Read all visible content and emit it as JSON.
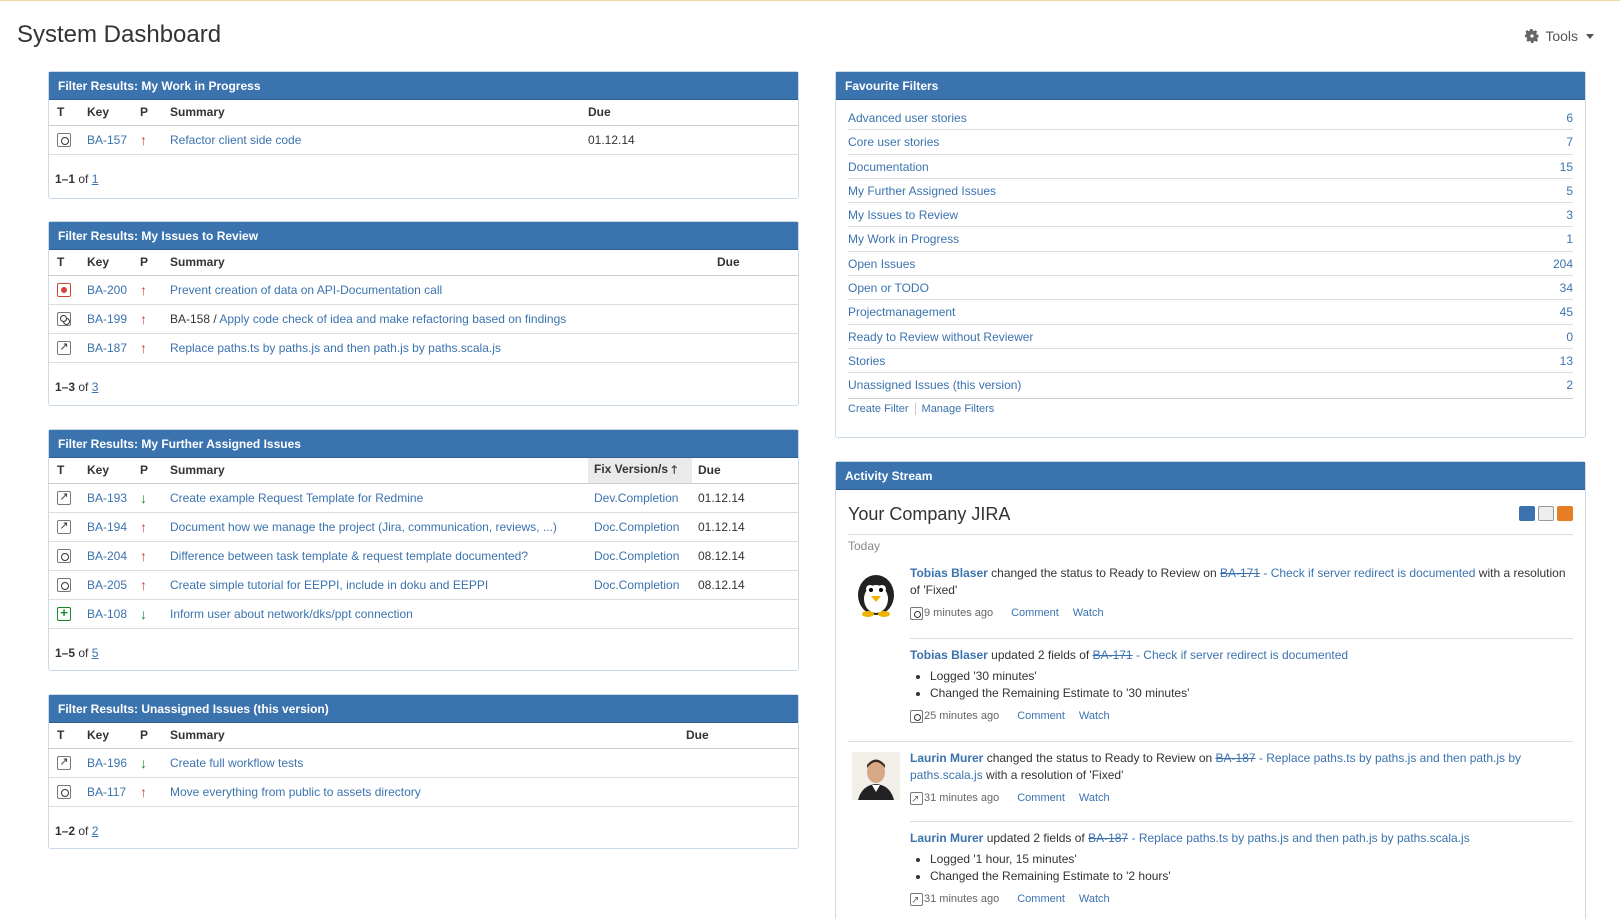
{
  "header": {
    "title": "System Dashboard",
    "tools_label": "Tools"
  },
  "gadgets": {
    "wip": {
      "title": "Filter Results: My Work in Progress",
      "cols": [
        "T",
        "Key",
        "P",
        "Summary",
        "Due"
      ],
      "rows": [
        {
          "type": "task",
          "key": "BA-157",
          "priority": "up",
          "summary": "Refactor client side code",
          "due": "01.12.14"
        }
      ],
      "pager": {
        "range": "1–1",
        "of": "of",
        "total": "1"
      }
    },
    "review": {
      "title": "Filter Results: My Issues to Review",
      "cols": [
        "T",
        "Key",
        "P",
        "Summary",
        "Due"
      ],
      "rows": [
        {
          "type": "bug",
          "key": "BA-200",
          "priority": "up",
          "parent": "",
          "summary": "Prevent creation of data on API-Documentation call",
          "due": ""
        },
        {
          "type": "sub",
          "key": "BA-199",
          "priority": "up",
          "parent": "BA-158",
          "summary": "Apply code check of idea and make refactoring based on findings",
          "due": ""
        },
        {
          "type": "imp",
          "key": "BA-187",
          "priority": "up",
          "parent": "",
          "summary": "Replace paths.ts by paths.js and then path.js by paths.scala.js",
          "due": ""
        }
      ],
      "pager": {
        "range": "1–3",
        "of": "of",
        "total": "3"
      }
    },
    "further": {
      "title": "Filter Results: My Further Assigned Issues",
      "cols": [
        "T",
        "Key",
        "P",
        "Summary",
        "Fix Version/s",
        "Due"
      ],
      "rows": [
        {
          "type": "imp",
          "key": "BA-193",
          "priority": "down",
          "summary": "Create example Request Template for Redmine",
          "fix": "Dev.Completion",
          "due": "01.12.14"
        },
        {
          "type": "imp",
          "key": "BA-194",
          "priority": "up",
          "summary": "Document how we manage the project (Jira, communication, reviews, ...)",
          "fix": "Doc.Completion",
          "due": "01.12.14"
        },
        {
          "type": "task",
          "key": "BA-204",
          "priority": "up",
          "summary": "Difference between task template & request template documented?",
          "fix": "Doc.Completion",
          "due": "08.12.14"
        },
        {
          "type": "task",
          "key": "BA-205",
          "priority": "up",
          "summary": "Create simple tutorial for EEPPI, include in doku and EEPPI",
          "fix": "Doc.Completion",
          "due": "08.12.14"
        },
        {
          "type": "new",
          "key": "BA-108",
          "priority": "down",
          "summary": "Inform user about network/dks/ppt connection",
          "fix": "",
          "due": ""
        }
      ],
      "pager": {
        "range": "1–5",
        "of": "of",
        "total": "5"
      }
    },
    "unassigned": {
      "title": "Filter Results: Unassigned Issues (this version)",
      "cols": [
        "T",
        "Key",
        "P",
        "Summary",
        "Due"
      ],
      "rows": [
        {
          "type": "imp",
          "key": "BA-196",
          "priority": "down",
          "summary": "Create full workflow tests",
          "due": ""
        },
        {
          "type": "task",
          "key": "BA-117",
          "priority": "up",
          "summary": "Move everything from public to assets directory",
          "due": ""
        }
      ],
      "pager": {
        "range": "1–2",
        "of": "of",
        "total": "2"
      }
    }
  },
  "favourites": {
    "title": "Favourite Filters",
    "items": [
      {
        "name": "Advanced user stories",
        "count": "6"
      },
      {
        "name": "Core user stories",
        "count": "7"
      },
      {
        "name": "Documentation",
        "count": "15"
      },
      {
        "name": "My Further Assigned Issues",
        "count": "5"
      },
      {
        "name": "My Issues to Review",
        "count": "3"
      },
      {
        "name": "My Work in Progress",
        "count": "1"
      },
      {
        "name": "Open Issues",
        "count": "204"
      },
      {
        "name": "Open or TODO",
        "count": "34"
      },
      {
        "name": "Projectmanagement",
        "count": "45"
      },
      {
        "name": "Ready to Review without Reviewer",
        "count": "0"
      },
      {
        "name": "Stories",
        "count": "13"
      },
      {
        "name": "Unassigned Issues (this version)",
        "count": "2"
      }
    ],
    "create_label": "Create Filter",
    "manage_label": "Manage Filters"
  },
  "activity": {
    "title": "Activity Stream",
    "stream_title": "Your Company JIRA",
    "today": "Today",
    "entries": [
      {
        "who": "Tobias Blaser",
        "verb": "changed the status to Ready to Review on",
        "key": "BA-171",
        "dash": "-",
        "link": "Check if server redirect is documented",
        "tail": "with a resolution of 'Fixed'",
        "time": "9 minutes ago",
        "comment": "Comment",
        "watch": "Watch"
      },
      {
        "who": "Tobias Blaser",
        "verb": "updated 2 fields of",
        "key": "BA-171",
        "dash": "-",
        "link": "Check if server redirect is documented",
        "bullets": [
          "Logged '30 minutes'",
          "Changed the Remaining Estimate to '30 minutes'"
        ],
        "time": "25 minutes ago",
        "comment": "Comment",
        "watch": "Watch"
      },
      {
        "who": "Laurin Murer",
        "verb": "changed the status to Ready to Review on",
        "key": "BA-187",
        "dash": "-",
        "link": "Replace paths.ts by paths.js and then path.js by paths.scala.js",
        "tail": "with a resolution of 'Fixed'",
        "time": "31 minutes ago",
        "comment": "Comment",
        "watch": "Watch"
      },
      {
        "who": "Laurin Murer",
        "verb": "updated 2 fields of",
        "key": "BA-187",
        "dash": "-",
        "link": "Replace paths.ts by paths.js and then path.js by paths.scala.js",
        "bullets": [
          "Logged '1 hour, 15 minutes'",
          "Changed the Remaining Estimate to '2 hours'"
        ],
        "time": "31 minutes ago",
        "comment": "Comment",
        "watch": "Watch"
      }
    ]
  }
}
